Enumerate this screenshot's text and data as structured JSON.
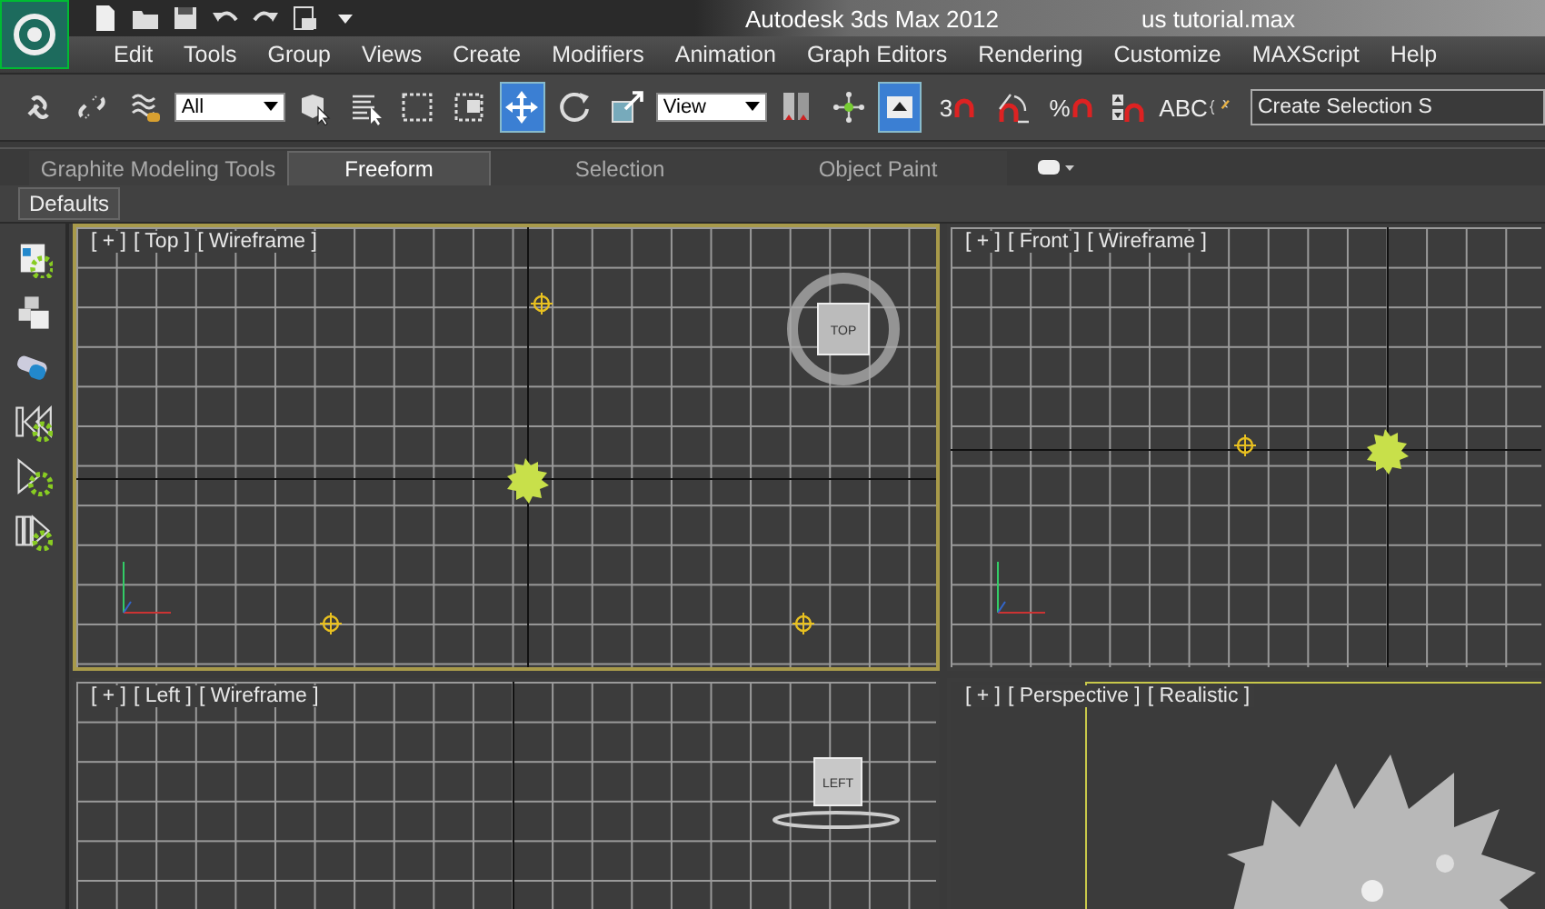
{
  "title_bar": {
    "title": "Autodesk 3ds Max 2012",
    "file": "us tutorial.max"
  },
  "menu": [
    "Edit",
    "Tools",
    "Group",
    "Views",
    "Create",
    "Modifiers",
    "Animation",
    "Graph Editors",
    "Rendering",
    "Customize",
    "MAXScript",
    "Help"
  ],
  "toolbar": [
    {
      "kind": "link",
      "selected": false
    },
    {
      "kind": "unlink",
      "selected": false
    },
    {
      "kind": "bind",
      "selected": false
    },
    {
      "kind": "dropdown",
      "value": "All"
    },
    {
      "kind": "select",
      "selected": false
    },
    {
      "kind": "select-by-name",
      "selected": false
    },
    {
      "kind": "region",
      "selected": false
    },
    {
      "kind": "window",
      "selected": false
    },
    {
      "kind": "move",
      "selected": true
    },
    {
      "kind": "rotate",
      "selected": false
    },
    {
      "kind": "scale",
      "selected": false
    },
    {
      "kind": "dropdown",
      "value": "View"
    },
    {
      "kind": "mirror",
      "selected": false
    },
    {
      "kind": "pivot",
      "selected": false
    },
    {
      "kind": "manipulate",
      "selected": true
    },
    {
      "kind": "snap",
      "label": "3",
      "selected": false
    },
    {
      "kind": "angle-snap",
      "selected": false
    },
    {
      "kind": "percent-snap",
      "label": "%",
      "selected": false
    },
    {
      "kind": "spinner-snap",
      "selected": false
    },
    {
      "kind": "edit-sets",
      "label": "ABC",
      "selected": false
    },
    {
      "kind": "field",
      "placeholder": "Create Selection S"
    }
  ],
  "ribbon_tabs": [
    {
      "label": "Graphite Modeling Tools",
      "selected": false
    },
    {
      "label": "Freeform",
      "selected": true
    },
    {
      "label": "Selection",
      "selected": false
    },
    {
      "label": "Object Paint",
      "selected": false
    }
  ],
  "ribbon_panel": "Defaults",
  "viewports": [
    {
      "kind": "top",
      "labels": [
        "[ + ]",
        "[ Top ]",
        "[ Wireframe ]"
      ],
      "active": true,
      "cube_label": "TOP"
    },
    {
      "kind": "front",
      "labels": [
        "[ + ]",
        "[ Front ]",
        "[ Wireframe ]"
      ],
      "active": false
    },
    {
      "kind": "left",
      "labels": [
        "[ + ]",
        "[ Left ]",
        "[ Wireframe ]"
      ],
      "active": false,
      "cube_label": "LEFT"
    },
    {
      "kind": "perspective",
      "labels": [
        "[ + ]",
        "[ Perspective ]",
        "[ Realistic ]"
      ],
      "active": false
    }
  ]
}
